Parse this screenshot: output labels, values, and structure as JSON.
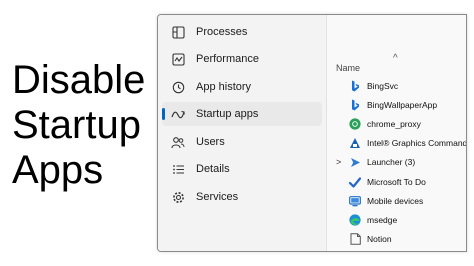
{
  "overlay": {
    "line1": "Disable",
    "line2": "Startup",
    "line3": "Apps"
  },
  "sidebar": {
    "items": [
      {
        "label": "Processes",
        "icon": "processes-icon"
      },
      {
        "label": "Performance",
        "icon": "performance-icon"
      },
      {
        "label": "App history",
        "icon": "history-icon"
      },
      {
        "label": "Startup apps",
        "icon": "startup-icon",
        "active": true
      },
      {
        "label": "Users",
        "icon": "users-icon"
      },
      {
        "label": "Details",
        "icon": "details-icon"
      },
      {
        "label": "Services",
        "icon": "services-icon"
      }
    ]
  },
  "table": {
    "sort_indicator": "^",
    "column_name": "Name",
    "rows": [
      {
        "label": "BingSvc",
        "icon": "bing-icon"
      },
      {
        "label": "BingWallpaperApp",
        "icon": "bing-icon"
      },
      {
        "label": "chrome_proxy",
        "icon": "chrome-icon"
      },
      {
        "label": "Intel® Graphics Command...",
        "icon": "intel-graphics-icon"
      },
      {
        "label": "Launcher (3)",
        "icon": "launcher-icon",
        "expandable": true,
        "expander": ">"
      },
      {
        "label": "Microsoft To Do",
        "icon": "todo-icon"
      },
      {
        "label": "Mobile devices",
        "icon": "mobile-devices-icon"
      },
      {
        "label": "msedge",
        "icon": "edge-icon"
      },
      {
        "label": "Notion",
        "icon": "notion-icon"
      }
    ]
  },
  "colors": {
    "accent": "#0067c0",
    "sidebar_bg": "#f3f3f3",
    "content_bg": "#f9f9f9",
    "active_bg": "#e9e9e9"
  }
}
